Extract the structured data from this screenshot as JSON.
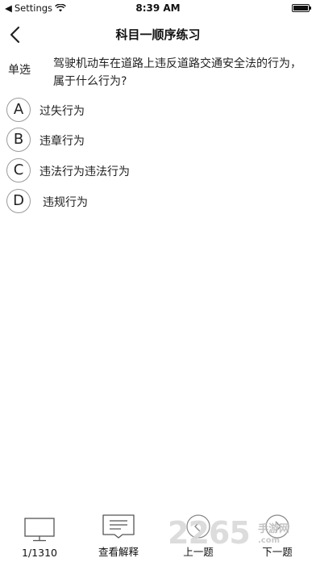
{
  "status_bar": {
    "carrier": "Settings",
    "time": "8:39 AM"
  },
  "nav": {
    "title": "科目一顺序练习"
  },
  "question": {
    "type": "单选",
    "text": "驾驶机动车在道路上违反道路交通安全法的行为，属于什么行为?"
  },
  "options": [
    {
      "letter": "A",
      "text": "过失行为"
    },
    {
      "letter": "B",
      "text": "违章行为"
    },
    {
      "letter": "C",
      "text": "违法行为违法行为"
    },
    {
      "letter": "D",
      "text": "违规行为"
    }
  ],
  "bottom_bar": {
    "progress": "1/1310",
    "explain": "查看解释",
    "prev": "上一题",
    "next": "下一题"
  },
  "watermark": {
    "number": "2265",
    "cn": "手游网",
    "url": ".com"
  }
}
